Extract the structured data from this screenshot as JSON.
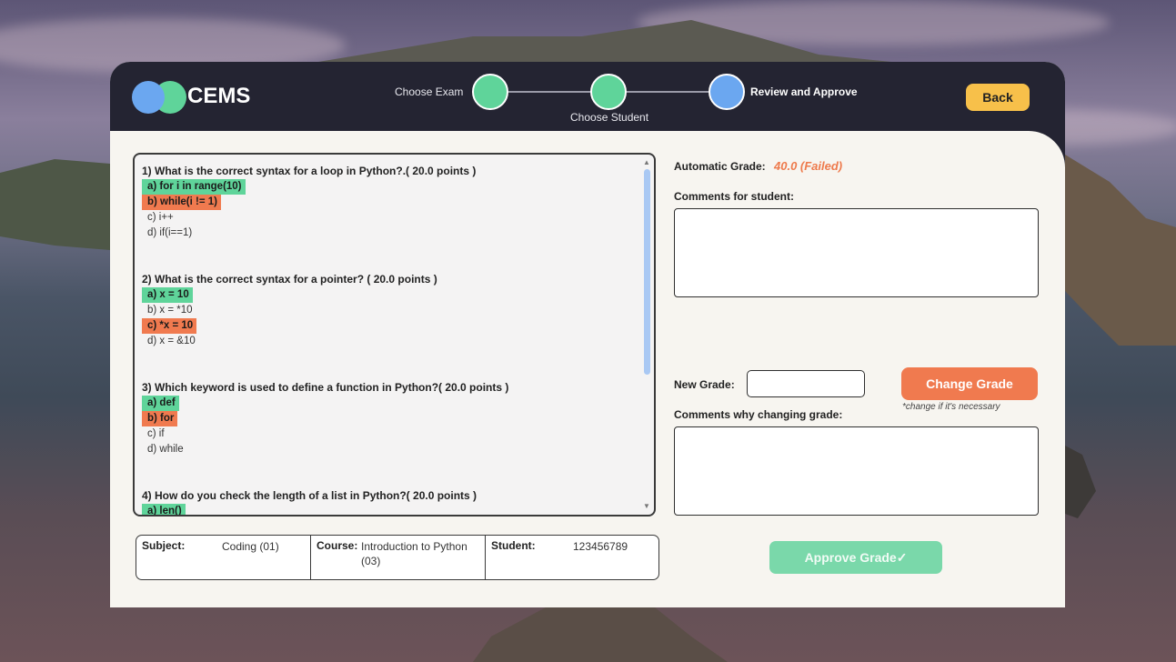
{
  "app": {
    "logo_text": "CEMS",
    "steps": [
      {
        "label": "Choose Exam"
      },
      {
        "label": "Choose Student"
      },
      {
        "label": "Review and Approve"
      }
    ],
    "back_label": "Back"
  },
  "colors": {
    "header_bg": "#242432",
    "step_done": "#5fd49a",
    "step_current": "#6ba7f0",
    "correct": "#5fd49a",
    "wrong": "#f07a4f",
    "back_button": "#f7c04a",
    "change_button": "#f07a4f",
    "approve_button": "#7ad8aa"
  },
  "questions": [
    {
      "title": "1) What is the correct syntax for a loop in Python?.( 20.0 points )",
      "options": [
        {
          "text": "a) for i in range(10)",
          "state": "correct"
        },
        {
          "text": "b) while(i != 1)",
          "state": "wrong"
        },
        {
          "text": "c) i++",
          "state": "none"
        },
        {
          "text": "d) if(i==1)",
          "state": "none"
        }
      ]
    },
    {
      "title": "2) What is the correct syntax for a pointer? ( 20.0 points )",
      "options": [
        {
          "text": "a) x = 10",
          "state": "correct"
        },
        {
          "text": "b) x = *10",
          "state": "none"
        },
        {
          "text": "c) *x = 10",
          "state": "wrong"
        },
        {
          "text": "d) x = &10",
          "state": "none"
        }
      ]
    },
    {
      "title": "3) Which keyword is used to define a function in Python?( 20.0 points )",
      "options": [
        {
          "text": "a) def",
          "state": "correct"
        },
        {
          "text": "b) for",
          "state": "wrong"
        },
        {
          "text": "c) if",
          "state": "none"
        },
        {
          "text": "d) while",
          "state": "none"
        }
      ]
    },
    {
      "title": "4) How do you check the length of a list in Python?( 20.0 points )",
      "options": [
        {
          "text": "a) len()",
          "state": "correct"
        }
      ]
    }
  ],
  "info": {
    "subject_label": "Subject:",
    "subject_value": "Coding (01)",
    "course_label": "Course:",
    "course_value": "Introduction to Python (03)",
    "student_label": "Student:",
    "student_value": "123456789"
  },
  "grading": {
    "auto_label": "Automatic Grade:",
    "auto_value": "40.0 (Failed)",
    "comments_label": "Comments for student:",
    "comments_value": "",
    "new_grade_label": "New Grade:",
    "new_grade_value": "",
    "change_label": "Change Grade",
    "change_hint": "*change if it's necessary",
    "reason_label": "Comments why changing grade:",
    "reason_value": "",
    "approve_label": "Approve Grade✓"
  }
}
